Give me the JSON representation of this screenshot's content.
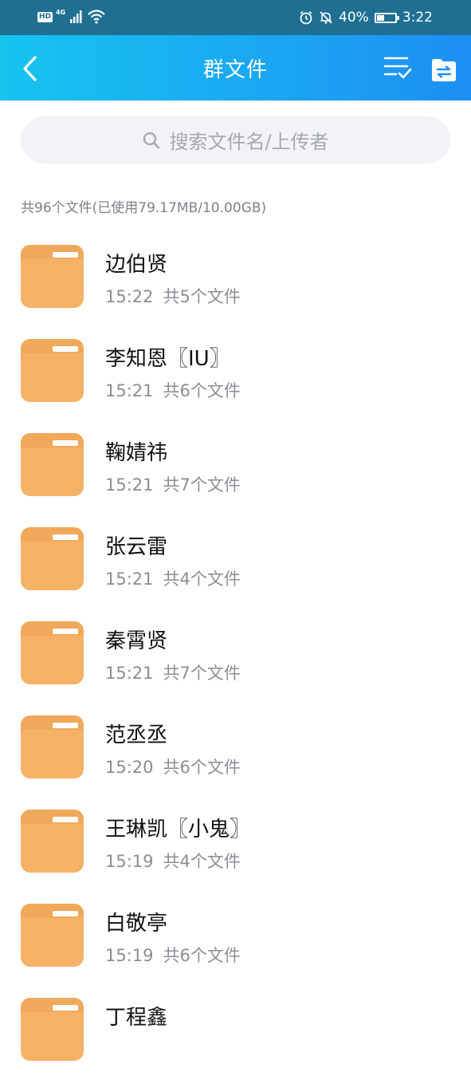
{
  "status_bar": {
    "hd": "HD",
    "network": "4G",
    "battery_percent": "40%",
    "time": "3:22",
    "battery_level": 0.4
  },
  "header": {
    "title": "群文件",
    "colors": {
      "gradient_start": "#16c4ef",
      "gradient_end": "#1d8ff3"
    }
  },
  "search": {
    "placeholder": "搜索文件名/上传者"
  },
  "summary": "共96个文件(已使用79.17MB/10.00GB)",
  "folders": [
    {
      "name": "边伯贤",
      "time": "15:22",
      "count": "共5个文件"
    },
    {
      "name": "李知恩〖IU〗",
      "time": "15:21",
      "count": "共6个文件"
    },
    {
      "name": "鞠婧祎",
      "time": "15:21",
      "count": "共7个文件"
    },
    {
      "name": "张云雷",
      "time": "15:21",
      "count": "共4个文件"
    },
    {
      "name": "秦霄贤",
      "time": "15:21",
      "count": "共7个文件"
    },
    {
      "name": "范丞丞",
      "time": "15:20",
      "count": "共6个文件"
    },
    {
      "name": "王琳凯〖小鬼〗",
      "time": "15:19",
      "count": "共4个文件"
    },
    {
      "name": "白敬亭",
      "time": "15:19",
      "count": "共6个文件"
    },
    {
      "name": "丁程鑫",
      "time": "",
      "count": ""
    }
  ]
}
